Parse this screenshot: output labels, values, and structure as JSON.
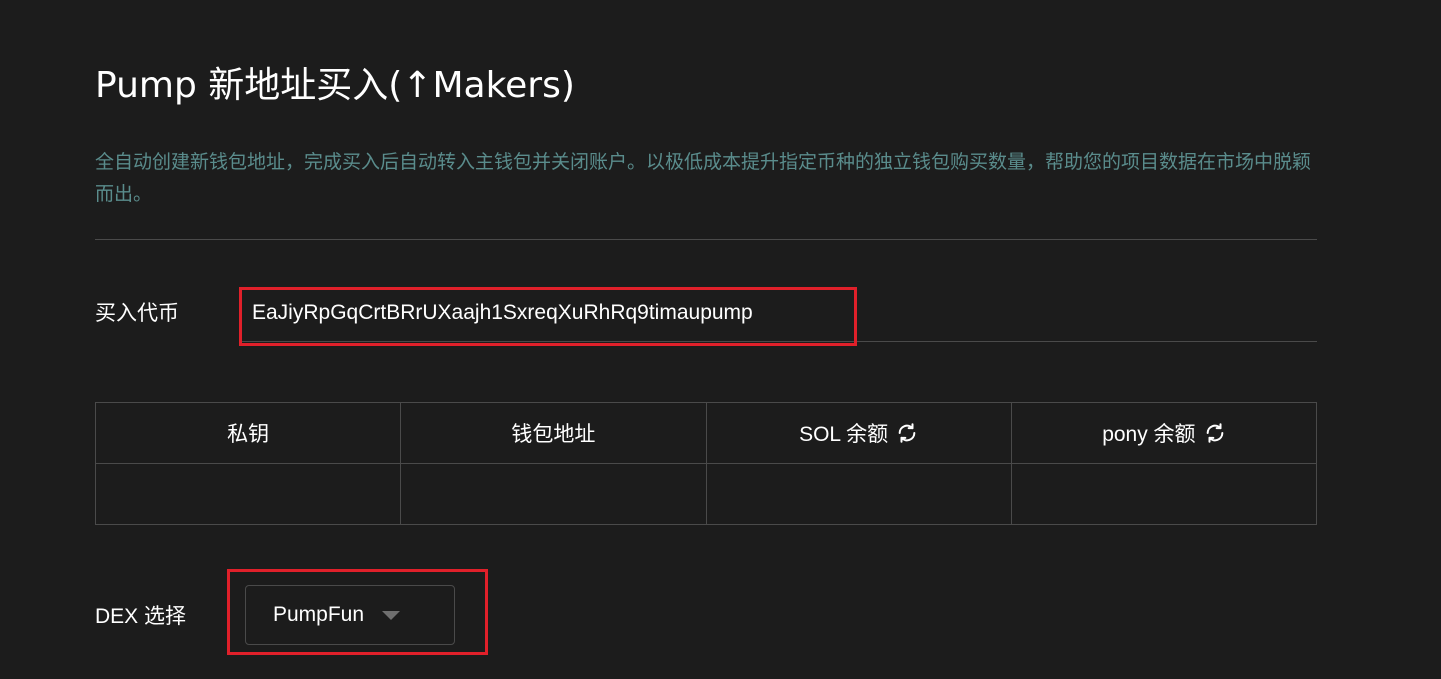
{
  "header": {
    "title": "Pump 新地址买入(↑Makers)",
    "description": "全自动创建新钱包地址，完成买入后自动转入主钱包并关闭账户。以极低成本提升指定币种的独立钱包购买数量，帮助您的项目数据在市场中脱颖而出。"
  },
  "token": {
    "label": "买入代币",
    "value": "EaJiyRpGqCrtBRrUXaajh1SxreqXuRhRq9timaupump"
  },
  "wallet_table": {
    "columns": [
      {
        "label": "私钥"
      },
      {
        "label": "钱包地址"
      },
      {
        "label": "SOL 余额",
        "icon": "refresh-icon"
      },
      {
        "label": "pony 余额",
        "icon": "refresh-icon"
      }
    ],
    "rows": []
  },
  "dex": {
    "label": "DEX 选择",
    "selected": "PumpFun"
  },
  "colors": {
    "background": "#1c1c1c",
    "description_text": "#5a8c8c",
    "border": "#4a4a4a",
    "highlight": "#e0202a"
  }
}
